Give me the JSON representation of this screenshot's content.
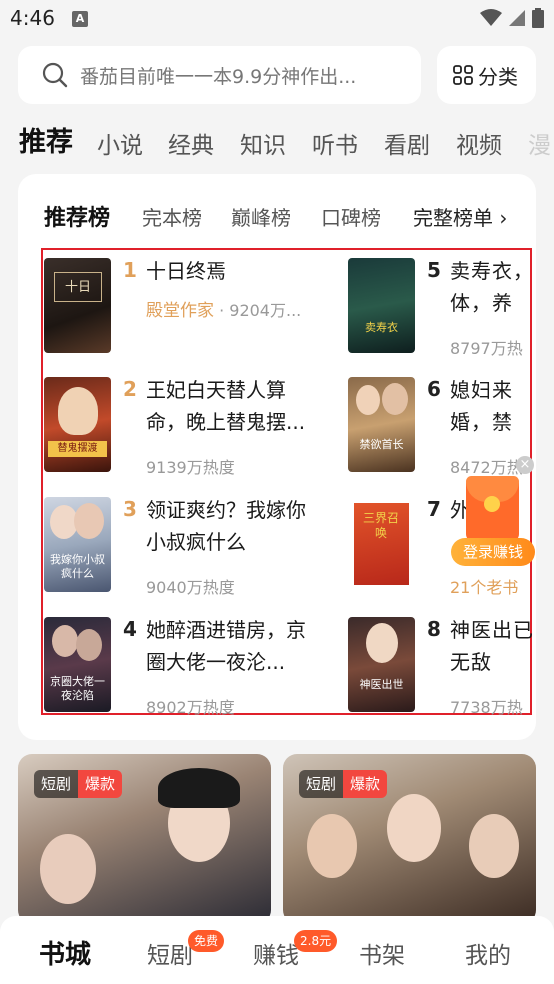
{
  "status": {
    "time": "4:46",
    "a_icon": "A"
  },
  "search": {
    "placeholder_text": "番茄目前唯一一本9.9分神作出...",
    "category_label": "分类"
  },
  "tabs": [
    "推荐",
    "小说",
    "经典",
    "知识",
    "听书",
    "看剧",
    "视频",
    "漫"
  ],
  "ranking": {
    "tabs": [
      "推荐榜",
      "完本榜",
      "巅峰榜",
      "口碑榜"
    ],
    "full_list": "完整榜单 ›",
    "books": [
      {
        "rank": "1",
        "title": "十日终焉",
        "author": "殿堂作家",
        "heat": " · 9204万..."
      },
      {
        "rank": "2",
        "title": "王妃白天替人算命，晚上替鬼摆...",
        "heat": "9139万热度"
      },
      {
        "rank": "3",
        "title": "领证爽约？我嫁你小叔疯什么",
        "heat": "9040万热度"
      },
      {
        "rank": "4",
        "title": "她醉酒进错房，京圈大佬一夜沦...",
        "heat": "8902万热度"
      },
      {
        "rank": "5",
        "title": "卖寿衣，体，养",
        "heat": "8797万热"
      },
      {
        "rank": "6",
        "title": "媳妇来婚，禁",
        "heat": "8472万热"
      },
      {
        "rank": "7",
        "title": "外",
        "heat": "21个老书"
      },
      {
        "rank": "8",
        "title": "神医出已无敌",
        "heat": "7738万热"
      }
    ]
  },
  "float": {
    "login_label": "登录赚钱",
    "close": "×"
  },
  "dramas": [
    {
      "tag1": "短剧",
      "tag2": "爆款"
    },
    {
      "tag1": "短剧",
      "tag2": "爆款"
    }
  ],
  "nav": {
    "items": [
      "书城",
      "短剧",
      "赚钱",
      "书架",
      "我的"
    ],
    "badge_free": "免费",
    "badge_money": "2.8元"
  },
  "colors": {
    "accent_rank_top": "#e0a05a",
    "highlight_box": "#e0202a",
    "badge": "#ff5a2a"
  }
}
